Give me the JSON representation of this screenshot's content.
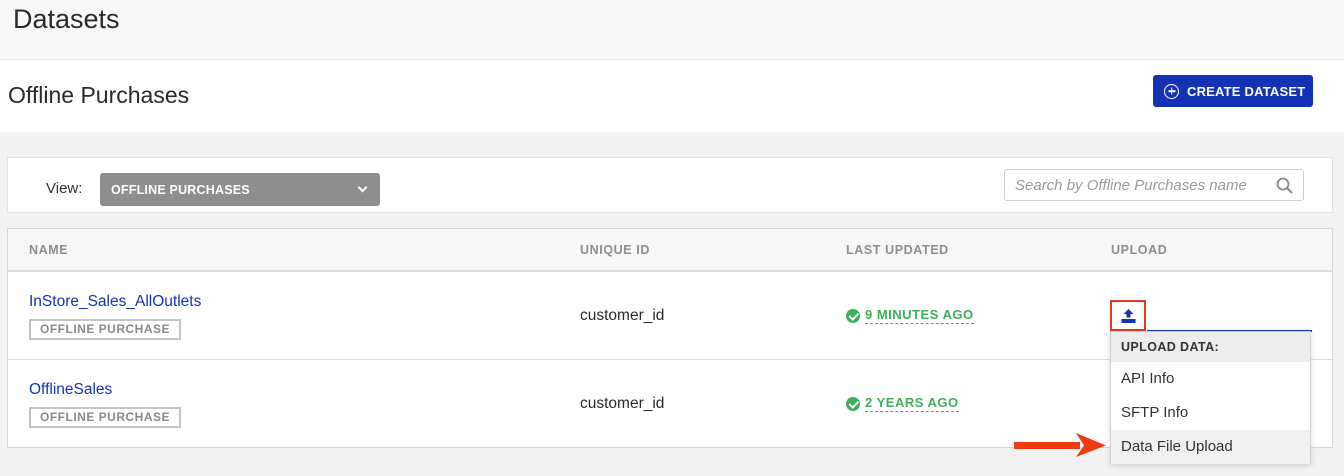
{
  "page": {
    "title": "Datasets"
  },
  "section": {
    "title": "Offline Purchases",
    "create_label": "CREATE DATASET"
  },
  "filter": {
    "view_label": "View:",
    "view_value": "OFFLINE PURCHASES",
    "search_placeholder": "Search by Offline Purchases name"
  },
  "table": {
    "headers": {
      "name": "NAME",
      "unique_id": "UNIQUE ID",
      "last_updated": "LAST UPDATED",
      "upload": "UPLOAD"
    },
    "rows": [
      {
        "name": "InStore_Sales_AllOutlets",
        "badge": "OFFLINE PURCHASE",
        "unique_id": "customer_id",
        "last_updated": "9 MINUTES AGO"
      },
      {
        "name": "OfflineSales",
        "badge": "OFFLINE PURCHASE",
        "unique_id": "customer_id",
        "last_updated": "2 YEARS AGO"
      }
    ]
  },
  "upload_menu": {
    "header": "UPLOAD DATA:",
    "items": [
      "API Info",
      "SFTP Info",
      "Data File Upload"
    ]
  },
  "colors": {
    "brand_blue": "#1432b4",
    "success_green": "#3cb15a",
    "highlight_red": "#e33a1a"
  },
  "icons": [
    "plus-circle-icon",
    "chevron-down-icon",
    "search-icon",
    "check-circle-icon",
    "upload-icon",
    "arrow-right-icon"
  ]
}
